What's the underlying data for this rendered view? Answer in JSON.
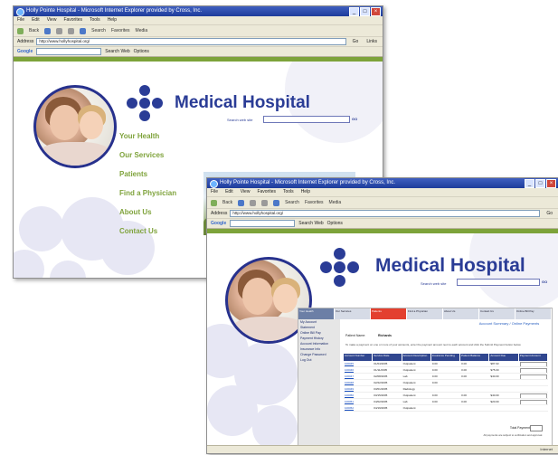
{
  "browser": {
    "title": "Holly Pointe Hospital - Microsoft Internet Explorer provided by Cross, Inc.",
    "menu": [
      "File",
      "Edit",
      "View",
      "Favorites",
      "Tools",
      "Help"
    ],
    "toolbar": [
      "Back",
      "Search",
      "Favorites",
      "Media"
    ],
    "address_label": "Address",
    "address_value": "http://www.hollyhospital.org/",
    "go_label": "Go",
    "links_label": "Links",
    "google_label": "Google",
    "google_search": "Search Web",
    "google_options": "Options",
    "status_text": "",
    "zone_text": "Internet"
  },
  "site": {
    "brand": "Medical Hospital",
    "search_label": "Search web site",
    "search_go": "GO",
    "nav": [
      "Your Health",
      "Our Services",
      "Patients",
      "Find a Physician",
      "About Us",
      "Contact Us"
    ]
  },
  "payment": {
    "tabs": [
      "Your Health",
      "Our Services",
      "Patients",
      "Find a Physician",
      "About Us",
      "Contact Us",
      "Online Bill Pay"
    ],
    "side_items": [
      "My Account",
      "Statement",
      "Online Bill Pay",
      "Payment History",
      "Account Information",
      "Insurance Info",
      "Change Password",
      "Log Out"
    ],
    "title": "Account Summary / Online Payments",
    "patient_label": "Patient Name:",
    "patient_value": "Richards",
    "help_text": "To make a payment on one or more of your accounts, enter the payment amount next to each account and click the Submit Payment button below.",
    "columns": [
      "Account Number",
      "Service Date",
      "Account Description",
      "Insurance Pending",
      "Patient Balance",
      "Amount Due",
      "Payment Amount"
    ],
    "rows": [
      [
        "100045",
        "01/04/2005",
        "Outpatient",
        "0.00",
        "0.00",
        "$87.93",
        ""
      ],
      [
        "100046",
        "01/11/2005",
        "Outpatient",
        "0.00",
        "0.00",
        "$75.00",
        ""
      ],
      [
        "100047",
        "02/08/2005",
        "Lab",
        "0.00",
        "0.00",
        "$40.00",
        ""
      ],
      [
        "100048",
        "02/22/2005",
        "Outpatient",
        "0.00",
        "",
        "",
        ""
      ],
      [
        "100049",
        "03/01/2005",
        "Radiology",
        "",
        "",
        "",
        ""
      ],
      [
        "100050",
        "03/15/2005",
        "Outpatient",
        "0.00",
        "0.00",
        "$40.00",
        ""
      ],
      [
        "100051",
        "04/02/2005",
        "Lab",
        "0.00",
        "0.00",
        "$20.00",
        ""
      ],
      [
        "100052",
        "04/19/2005",
        "Outpatient",
        "",
        "",
        "",
        ""
      ]
    ],
    "total_label": "Total Payment",
    "footnote": "All payments are subject to verification and approval."
  }
}
